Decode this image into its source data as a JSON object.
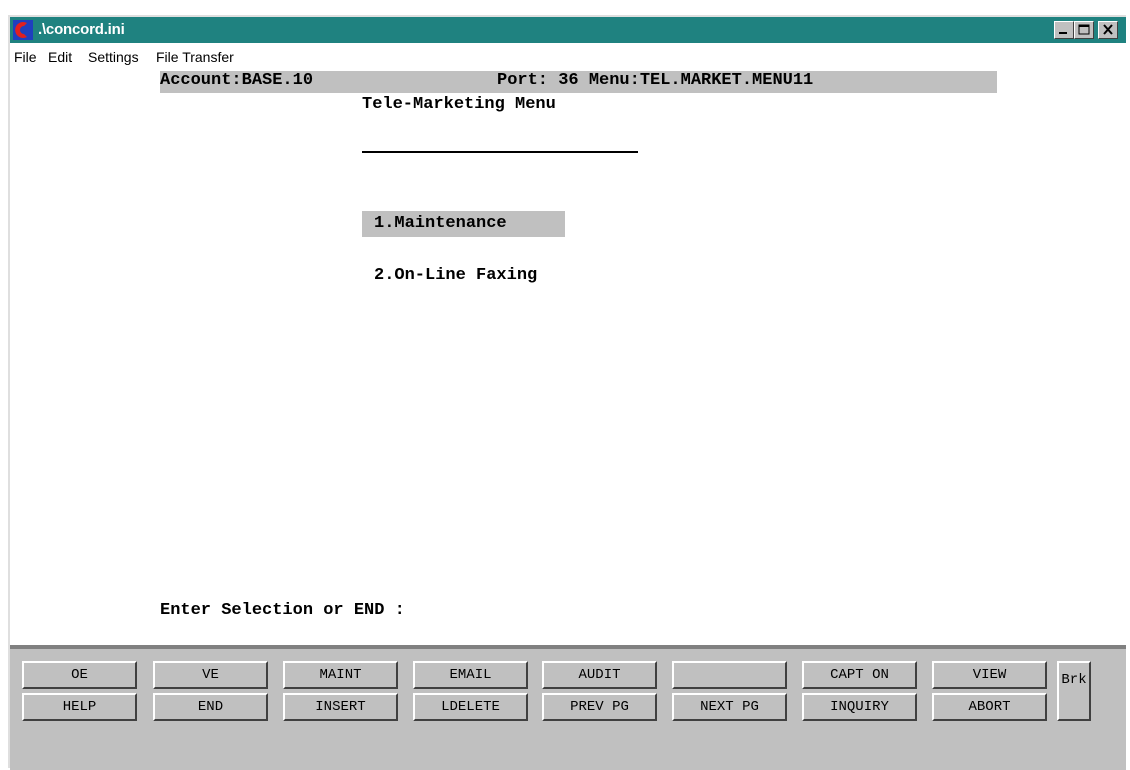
{
  "window": {
    "title": ".\\concord.ini",
    "colors": {
      "titlebar": "#1f8280",
      "face": "#c0c0c0"
    }
  },
  "menubar": {
    "items": [
      "File",
      "Edit",
      "Settings",
      "File Transfer"
    ]
  },
  "terminal": {
    "status": {
      "account": "Account:BASE.10",
      "port_menu": "Port: 36 Menu:TEL.MARKET.MENU11"
    },
    "menu_title": "Tele-Marketing Menu",
    "options": [
      "1.Maintenance",
      "2.On-Line Faxing"
    ],
    "selected_option": 0,
    "prompt": "Enter Selection or END :"
  },
  "function_keys": {
    "row1": [
      "OE",
      "VE",
      "MAINT",
      "EMAIL",
      "AUDIT",
      "",
      "CAPT ON",
      "VIEW"
    ],
    "row2": [
      "HELP",
      "END",
      "INSERT",
      "LDELETE",
      "PREV PG",
      "NEXT PG",
      "INQUIRY",
      "ABORT"
    ],
    "brk": "Brk"
  }
}
